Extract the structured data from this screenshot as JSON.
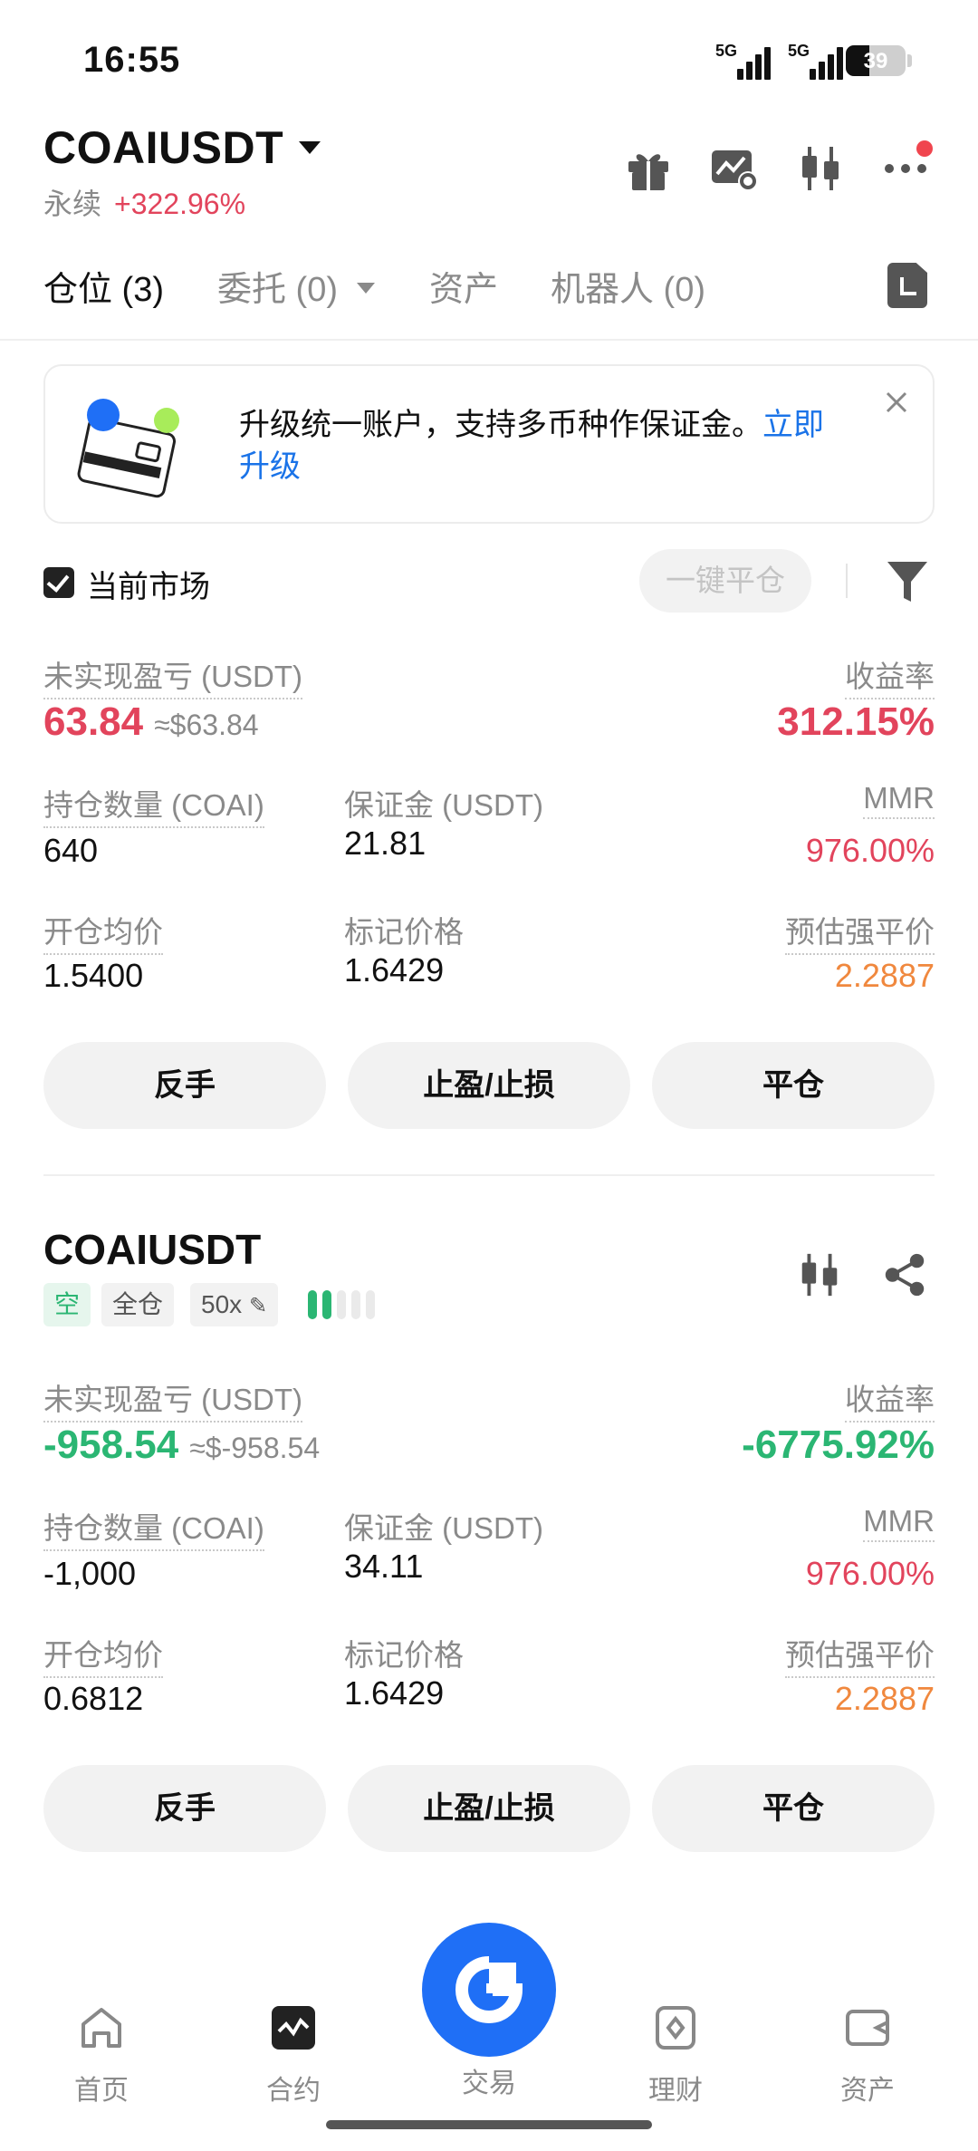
{
  "status_bar": {
    "time": "16:55",
    "network1": "5G",
    "network2": "5G",
    "battery": "39",
    "battery_level": 0.39
  },
  "header": {
    "symbol": "COAIUSDT",
    "contract_type": "永续",
    "change": "+322.96%",
    "icons": [
      "gift-icon",
      "chart-settings-icon",
      "candlestick-icon",
      "more-icon"
    ]
  },
  "tabs": [
    {
      "label": "仓位 (3)",
      "active": true
    },
    {
      "label": "委托 (0)",
      "active": false
    },
    {
      "label": "资产",
      "active": false
    },
    {
      "label": "机器人 (0)",
      "active": false
    }
  ],
  "banner": {
    "message": "升级统一账户，支持多币种作保证金。",
    "link_line1": "立即",
    "link_line2": "升级"
  },
  "filter": {
    "current_market_label": "当前市场",
    "current_market_checked": true,
    "close_all_label": "一键平仓"
  },
  "positions": [
    {
      "pnl_label": "未实现盈亏 (USDT)",
      "pnl": "63.84",
      "pnl_approx": "≈$63.84",
      "roi_label": "收益率",
      "roi": "312.15%",
      "qty_label": "持仓数量 (COAI)",
      "qty": "640",
      "margin_label": "保证金 (USDT)",
      "margin": "21.81",
      "mmr_label": "MMR",
      "mmr": "976.00%",
      "entry_label": "开仓均价",
      "entry": "1.5400",
      "mark_label": "标记价格",
      "mark": "1.6429",
      "liq_label": "预估强平价",
      "liq": "2.2887",
      "buttons": {
        "reverse": "反手",
        "tpsl": "止盈/止损",
        "close": "平仓"
      }
    },
    {
      "title": "COAIUSDT",
      "side": "空",
      "margin_mode": "全仓",
      "leverage": "50x",
      "pnl_label": "未实现盈亏 (USDT)",
      "pnl": "-958.54",
      "pnl_approx": "≈$-958.54",
      "roi_label": "收益率",
      "roi": "-6775.92%",
      "qty_label": "持仓数量 (COAI)",
      "qty": "-1,000",
      "margin_label": "保证金 (USDT)",
      "margin": "34.11",
      "mmr_label": "MMR",
      "mmr": "976.00%",
      "entry_label": "开仓均价",
      "entry": "0.6812",
      "mark_label": "标记价格",
      "mark": "1.6429",
      "liq_label": "预估强平价",
      "liq": "2.2887",
      "buttons": {
        "reverse": "反手",
        "tpsl": "止盈/止损",
        "close": "平仓"
      }
    }
  ],
  "bottom_nav": [
    {
      "label": "首页",
      "icon": "home-icon"
    },
    {
      "label": "合约",
      "icon": "futures-icon",
      "active": true
    },
    {
      "label": "交易",
      "icon": "trade-icon"
    },
    {
      "label": "理财",
      "icon": "earn-icon"
    },
    {
      "label": "资产",
      "icon": "wallet-icon"
    }
  ],
  "colors": {
    "up": "#e2445c",
    "down": "#2bb673",
    "warning": "#f0883e",
    "link": "#1a73e8",
    "primary": "#1f6ff6"
  }
}
